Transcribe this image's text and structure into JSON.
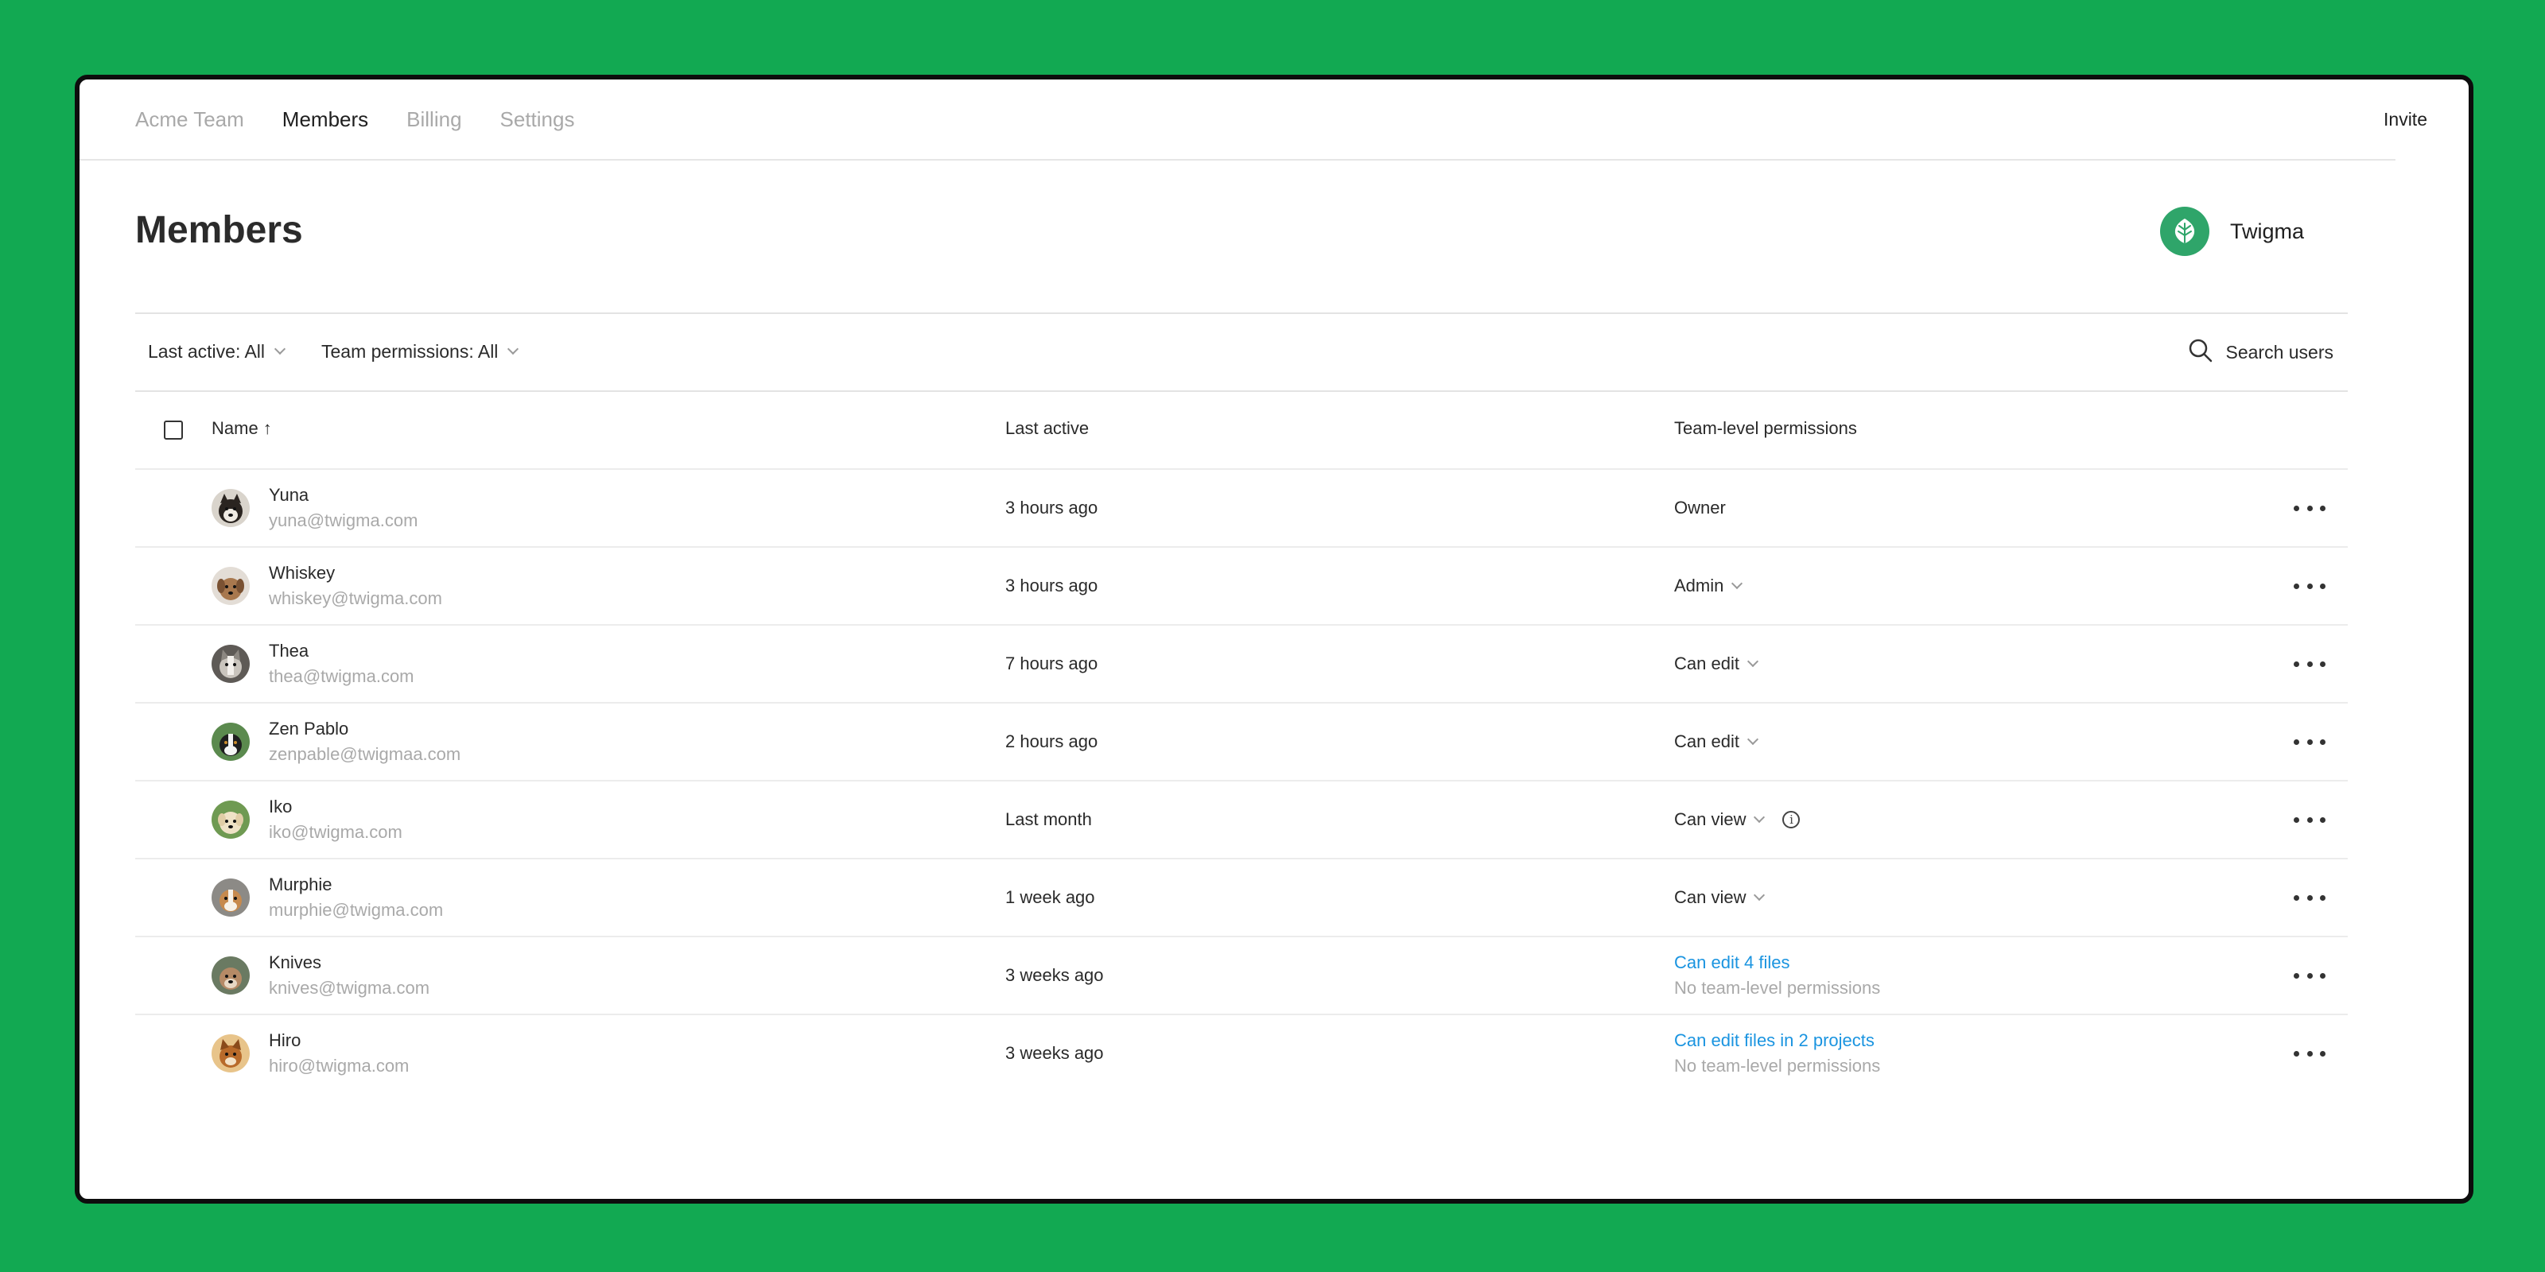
{
  "nav": {
    "tabs": [
      {
        "label": "Acme Team"
      },
      {
        "label": "Members"
      },
      {
        "label": "Billing"
      },
      {
        "label": "Settings"
      }
    ],
    "active_tab": "Members",
    "invite_label": "Invite"
  },
  "header": {
    "title": "Members",
    "team_name": "Twigma",
    "team_logo_icon": "leaf-icon",
    "team_logo_color": "#2fa56a"
  },
  "filters": {
    "last_active": "Last active: All",
    "team_permissions": "Team permissions: All",
    "search_placeholder": "Search users"
  },
  "table": {
    "columns": {
      "name": "Name ↑",
      "last_active": "Last active",
      "permissions": "Team-level permissions"
    },
    "rows": [
      {
        "name": "Yuna",
        "email": "yuna@twigma.com",
        "last_active": "3 hours ago",
        "permission": "Owner"
      },
      {
        "name": "Whiskey",
        "email": "whiskey@twigma.com",
        "last_active": "3 hours ago",
        "permission": "Admin"
      },
      {
        "name": "Thea",
        "email": "thea@twigma.com",
        "last_active": "7 hours ago",
        "permission": "Can edit"
      },
      {
        "name": "Zen Pablo",
        "email": "zenpable@twigmaa.com",
        "last_active": "2 hours ago",
        "permission": "Can edit"
      },
      {
        "name": "Iko",
        "email": "iko@twigma.com",
        "last_active": "Last month",
        "permission": "Can view"
      },
      {
        "name": "Murphie",
        "email": "murphie@twigma.com",
        "last_active": "1 week ago",
        "permission": "Can view"
      },
      {
        "name": "Knives",
        "email": "knives@twigma.com",
        "last_active": "3 weeks ago",
        "permission": "Can edit 4 files",
        "permission_sub": "No team-level permissions"
      },
      {
        "name": "Hiro",
        "email": "hiro@twigma.com",
        "last_active": "3 weeks ago",
        "permission": "Can edit files in 2 projects",
        "permission_sub": "No team-level permissions"
      }
    ]
  },
  "colors": {
    "background": "#12a952",
    "link": "#1a94e0"
  }
}
